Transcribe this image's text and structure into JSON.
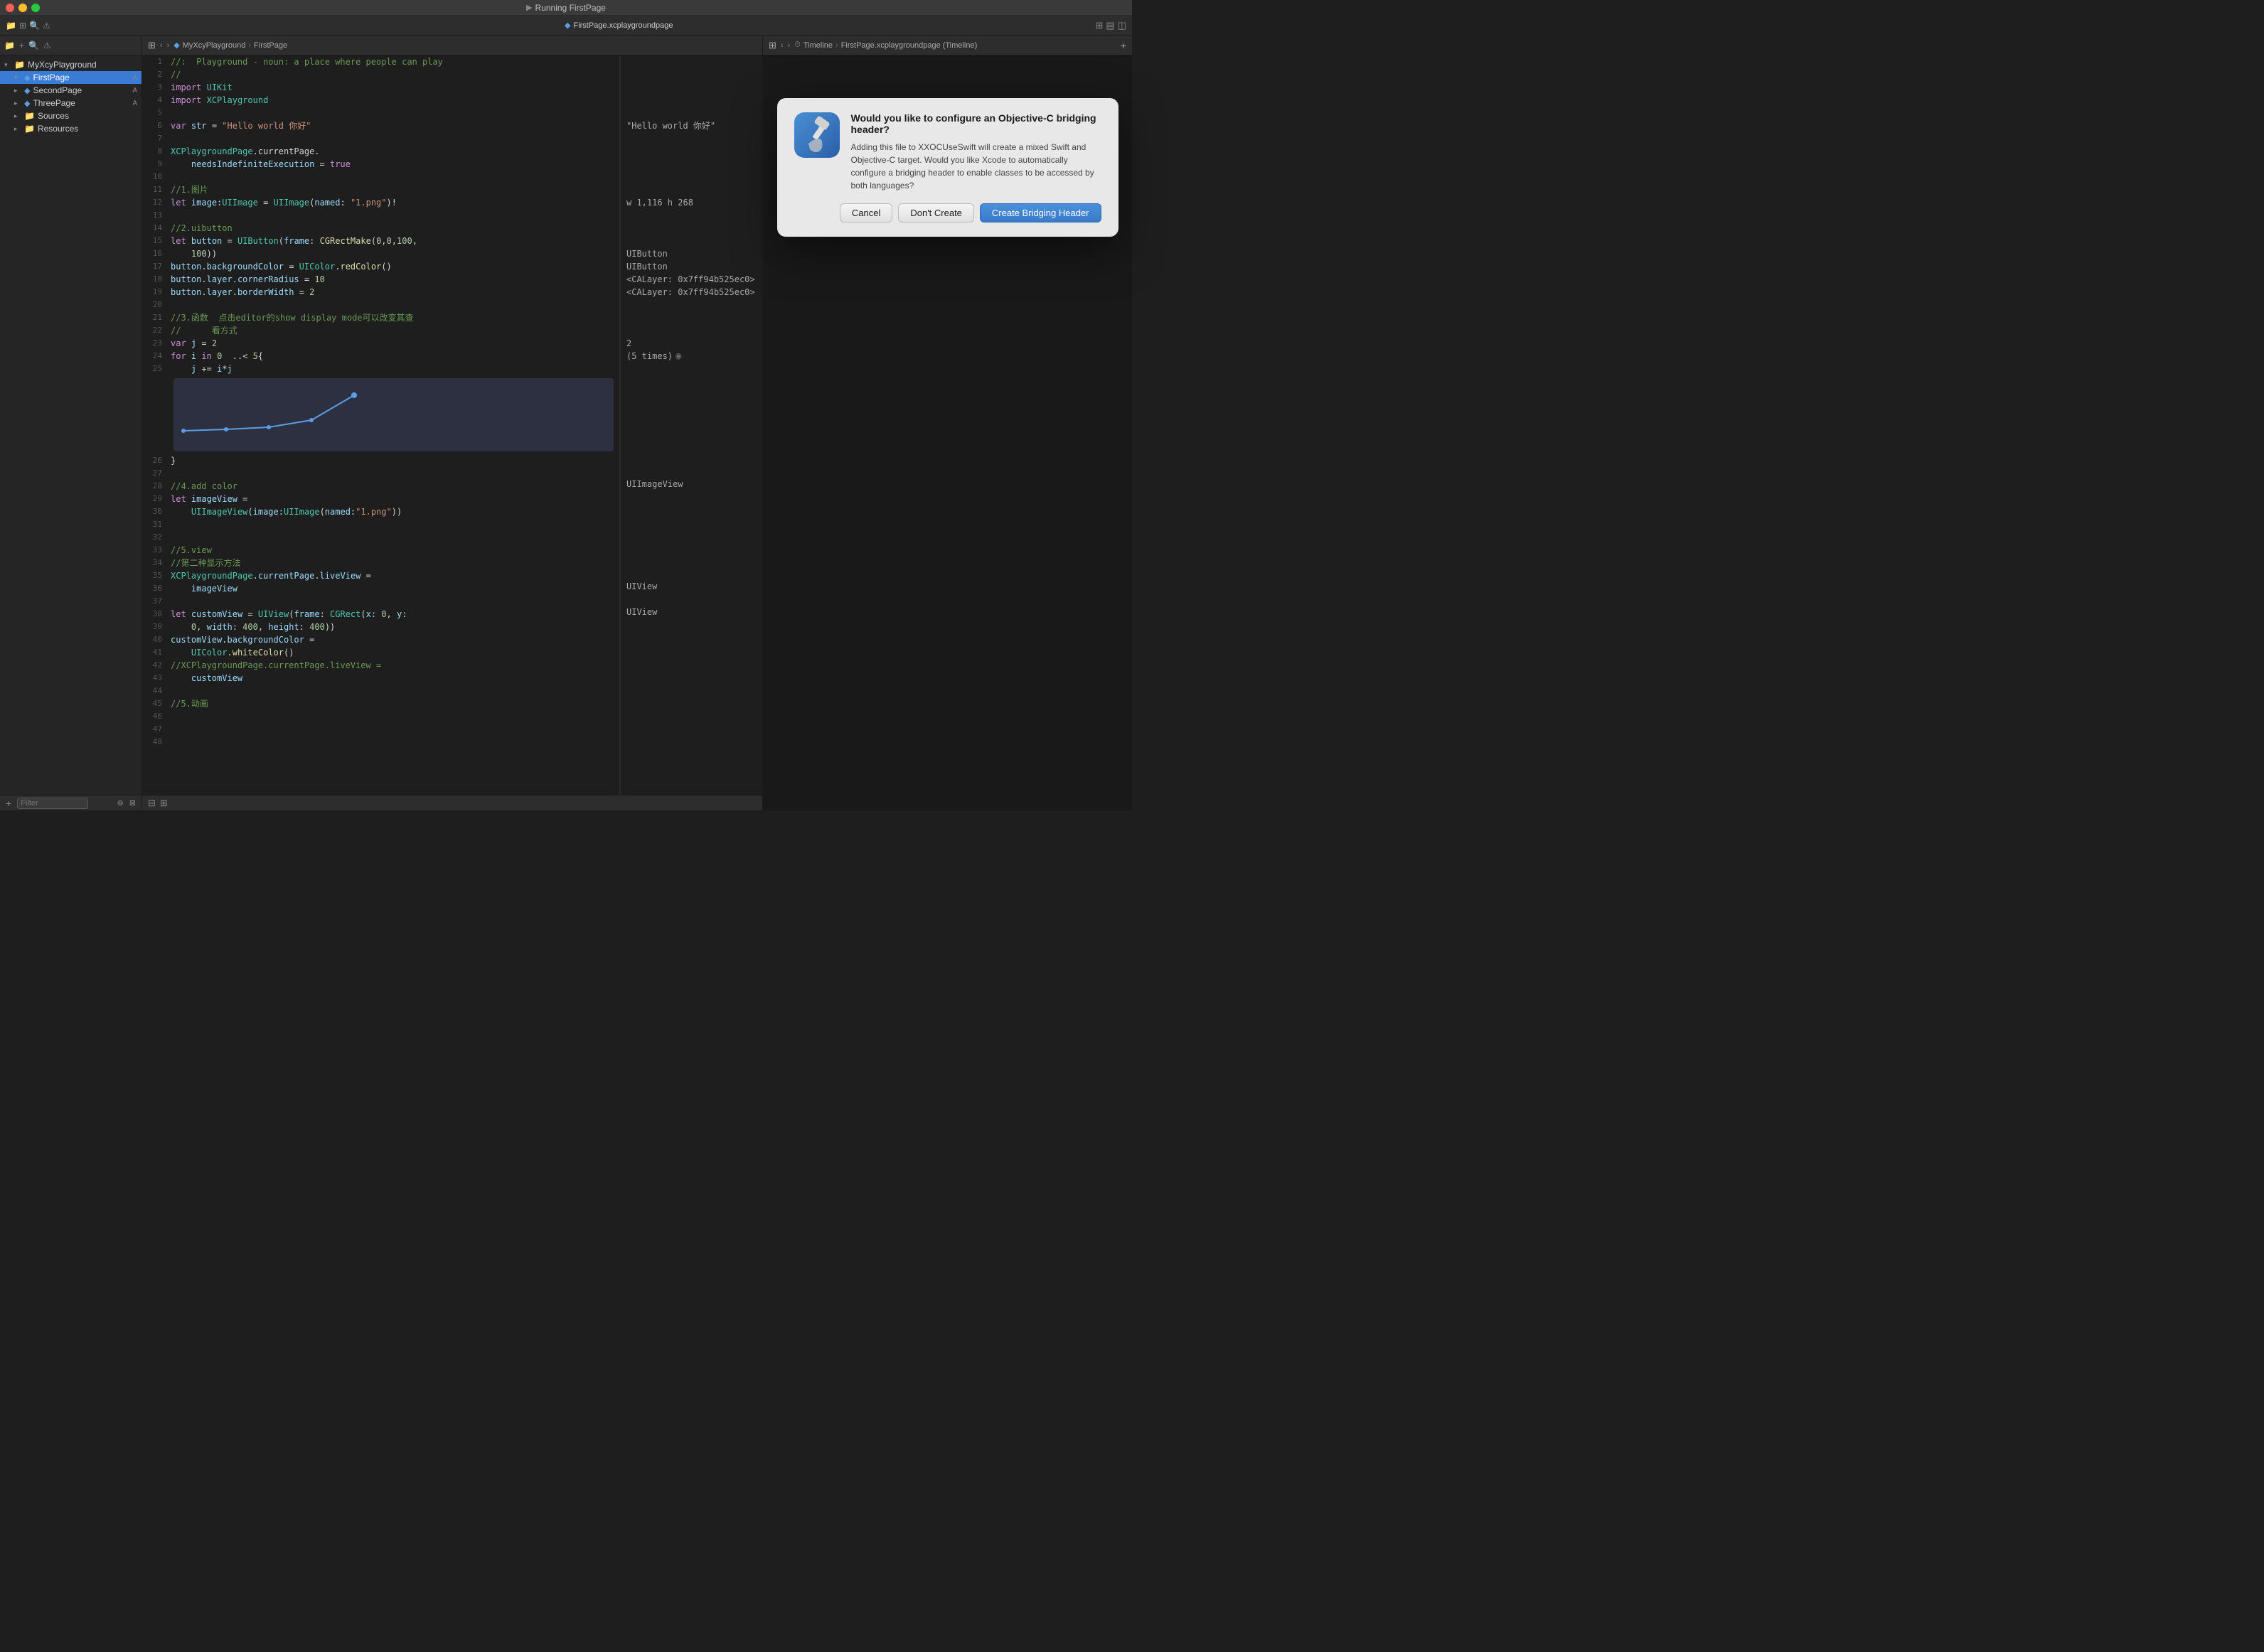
{
  "titlebar": {
    "title": "Running FirstPage",
    "tab_title": "FirstPage.xcplaygroundpage"
  },
  "toolbar": {
    "nav_back": "‹",
    "nav_forward": "›",
    "breadcrumb": [
      "MyXcyPlayground",
      "›",
      "FirstPage"
    ]
  },
  "right_toolbar": {
    "breadcrumb": [
      "Timeline",
      "›",
      "FirstPage.xcplaygroundpage (Timeline)"
    ],
    "plus_label": "+"
  },
  "sidebar": {
    "items": [
      {
        "id": "myxcyplayground",
        "label": "MyXcyPlayground",
        "indent": 0,
        "disclosure": "▾",
        "icon": "📁",
        "badge": ""
      },
      {
        "id": "firstpage",
        "label": "FirstPage",
        "indent": 1,
        "disclosure": "▾",
        "icon": "📄",
        "badge": "A",
        "selected": true
      },
      {
        "id": "secondpage",
        "label": "SecondPage",
        "indent": 1,
        "disclosure": "▸",
        "icon": "📄",
        "badge": "A"
      },
      {
        "id": "threepage",
        "label": "ThreePage",
        "indent": 1,
        "disclosure": "▸",
        "icon": "📄",
        "badge": "A"
      },
      {
        "id": "sources",
        "label": "Sources",
        "indent": 1,
        "disclosure": "▸",
        "icon": "📁",
        "badge": ""
      },
      {
        "id": "resources",
        "label": "Resources",
        "indent": 1,
        "disclosure": "▸",
        "icon": "📁",
        "badge": ""
      }
    ],
    "filter_placeholder": "Filter"
  },
  "code": [
    {
      "num": 1,
      "content": "//:  Playground - noun: a place where people can",
      "type": "comment"
    },
    {
      "num": 2,
      "content": "//       play",
      "type": "comment"
    },
    {
      "num": 3,
      "content": "import UIKit",
      "type": "code"
    },
    {
      "num": 4,
      "content": "import XCPlayground",
      "type": "code"
    },
    {
      "num": 5,
      "content": ""
    },
    {
      "num": 6,
      "content": "var str = \"Hello world 你好\"",
      "type": "code"
    },
    {
      "num": 7,
      "content": ""
    },
    {
      "num": 8,
      "content": "XCPlaygroundPage.currentPage.",
      "type": "code"
    },
    {
      "num": 9,
      "content": "    needsIndefiniteExecution = true",
      "type": "code"
    },
    {
      "num": 10,
      "content": ""
    },
    {
      "num": 11,
      "content": "//1.图片",
      "type": "comment"
    },
    {
      "num": 12,
      "content": "let image:UIImage = UIImage(named: \"1.png\")!",
      "type": "code"
    },
    {
      "num": 13,
      "content": ""
    },
    {
      "num": 14,
      "content": "//2.uibutton",
      "type": "comment"
    },
    {
      "num": 15,
      "content": "let button = UIButton(frame: CGRectMake(0,0,100,",
      "type": "code"
    },
    {
      "num": 16,
      "content": "    100))",
      "type": "code"
    },
    {
      "num": 17,
      "content": "button.backgroundColor = UIColor.redColor()",
      "type": "code"
    },
    {
      "num": 18,
      "content": "button.layer.cornerRadius = 10",
      "type": "code"
    },
    {
      "num": 19,
      "content": "button.layer.borderWidth = 2",
      "type": "code"
    },
    {
      "num": 20,
      "content": ""
    },
    {
      "num": 21,
      "content": "//3.函数  点击editor的show display mode可以改变其查",
      "type": "comment"
    },
    {
      "num": 22,
      "content": "//      看方式",
      "type": "comment"
    },
    {
      "num": 23,
      "content": "var j = 2",
      "type": "code"
    },
    {
      "num": 24,
      "content": "for i in 0  ..< 5{",
      "type": "code"
    },
    {
      "num": 25,
      "content": "    j += i*j",
      "type": "code"
    },
    {
      "num": 26,
      "content": ""
    },
    {
      "num": 27,
      "content": "}",
      "type": "code"
    },
    {
      "num": 28,
      "content": ""
    },
    {
      "num": 29,
      "content": "//4.add color",
      "type": "comment"
    },
    {
      "num": 30,
      "content": "let imageView =",
      "type": "code"
    },
    {
      "num": 31,
      "content": "    UIImageView(image:UIImage(named:\"1.png\"))",
      "type": "code"
    },
    {
      "num": 32,
      "content": ""
    },
    {
      "num": 33,
      "content": ""
    },
    {
      "num": 34,
      "content": "//5.view",
      "type": "comment"
    },
    {
      "num": 35,
      "content": "//第二种显示方法",
      "type": "comment"
    },
    {
      "num": 36,
      "content": "XCPlaygroundPage.currentPage.liveView =",
      "type": "code"
    },
    {
      "num": 37,
      "content": "    imageView",
      "type": "code"
    },
    {
      "num": 38,
      "content": ""
    },
    {
      "num": 39,
      "content": "let customView = UIView(frame: CGRect(x: 0, y:",
      "type": "code"
    },
    {
      "num": 40,
      "content": "    0, width: 400, height: 400))",
      "type": "code"
    },
    {
      "num": 41,
      "content": "customView.backgroundColor =",
      "type": "code"
    },
    {
      "num": 42,
      "content": "    UIColor.whiteColor()",
      "type": "code"
    },
    {
      "num": 43,
      "content": "//XCPlaygroundPage.currentPage.liveView =",
      "type": "comment"
    },
    {
      "num": 44,
      "content": "    customView",
      "type": "code"
    },
    {
      "num": 45,
      "content": ""
    },
    {
      "num": 46,
      "content": "//5.动画",
      "type": "comment"
    },
    {
      "num": 47,
      "content": ""
    },
    {
      "num": 48,
      "content": ""
    }
  ],
  "output": [
    {
      "line": 6,
      "value": "\"Hello world 你好\""
    },
    {
      "line": 12,
      "value": "w 1,116 h 268"
    },
    {
      "line": 15,
      "value": ""
    },
    {
      "line": 15,
      "value": "UIButton"
    },
    {
      "line": 17,
      "value": "UIButton"
    },
    {
      "line": 17,
      "value": "<CALayer: 0x7ff94b525ec0>"
    },
    {
      "line": 17,
      "value": "<CALayer: 0x7ff94b525ec0>"
    },
    {
      "line": 23,
      "value": "2"
    },
    {
      "line": 25,
      "value": "(5 times)"
    },
    {
      "line": 30,
      "value": "UIImageView"
    },
    {
      "line": 36,
      "value": ""
    },
    {
      "line": 39,
      "value": "UIView"
    },
    {
      "line": 41,
      "value": "UIView"
    }
  ],
  "dialog": {
    "title": "Would you like to configure an Objective-C bridging header?",
    "message": "Adding this file to XXOCUseSwift will create a mixed Swift and Objective-C target. Would you like Xcode to automatically configure a bridging header to enable classes to be accessed by both languages?",
    "cancel_label": "Cancel",
    "dont_create_label": "Don't Create",
    "create_label": "Create Bridging Header"
  },
  "bottom_bar": {
    "filter_placeholder": "Filter",
    "left_icons": [
      "⊞",
      "⊟"
    ]
  },
  "colors": {
    "bg": "#1e1e1e",
    "sidebar_bg": "#252525",
    "toolbar_bg": "#2d2d2d",
    "accent": "#3a7bd5",
    "comment": "#6a9955",
    "keyword": "#cf8fdb",
    "type": "#4ec9b0",
    "string": "#ce9178",
    "number": "#b5cea8",
    "func_color": "#dcdcaa",
    "var_color": "#9cdcfe"
  }
}
